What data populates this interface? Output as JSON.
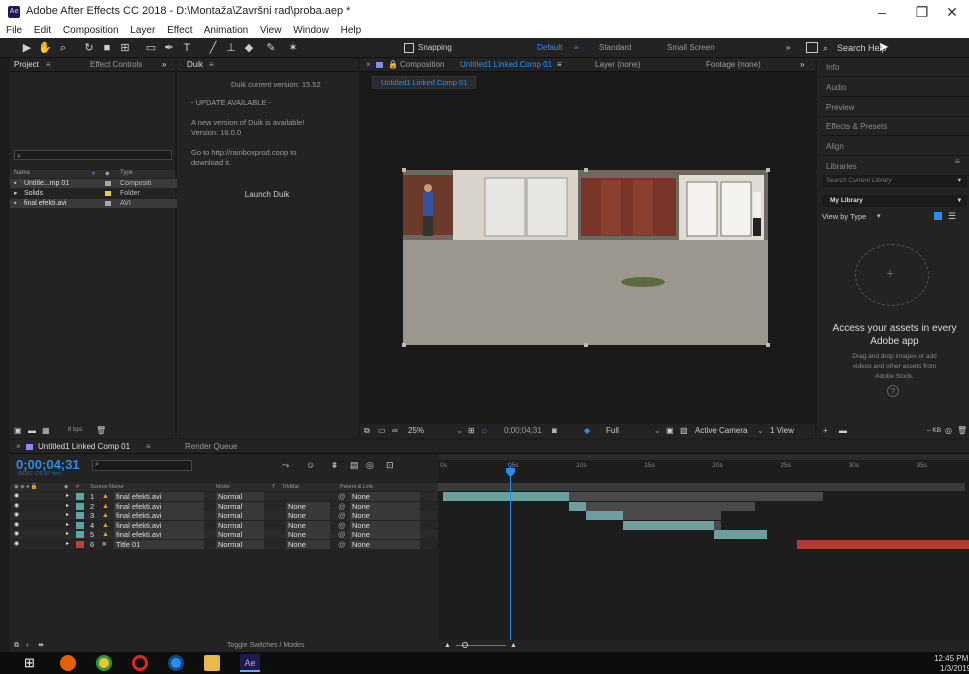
{
  "window": {
    "title": "Adobe After Effects CC 2018 - D:\\Montaža\\Završni rad\\proba.aep *",
    "app_icon": "Ae",
    "minimize": "–",
    "restore": "❐",
    "close": "✕"
  },
  "menu": [
    "File",
    "Edit",
    "Composition",
    "Layer",
    "Effect",
    "Animation",
    "View",
    "Window",
    "Help"
  ],
  "toolbar": {
    "snapping": "Snapping",
    "workspaces": [
      "Default",
      "≡",
      "Standard",
      "Small Screen"
    ],
    "search_help": "Search Help"
  },
  "project": {
    "tab_project": "Project",
    "tab_effect_controls": "Effect Controls",
    "col_name": "Name",
    "col_type": "Type",
    "items": [
      {
        "name": "Untitle...mp 01",
        "type": "Compositi",
        "color": "#a7a7a7"
      },
      {
        "name": "Solids",
        "type": "Folder",
        "color": "#e2d04a"
      },
      {
        "name": "final efekti.avi",
        "type": "AVI",
        "color": "#a7a7a7"
      }
    ],
    "bpc": "8 bpc"
  },
  "duik": {
    "tab": "Duik",
    "version": "Duik current version: 15.52",
    "update": "- UPDATE AVAILABLE -",
    "new_version": "A new version of Duik is available!",
    "version_num": "Version: 16.0.0",
    "goto": "Go to http://rainboxprod.coop to",
    "download": "download it.",
    "launch": "Launch Duik"
  },
  "composition": {
    "tab_label": "Composition",
    "comp_name": "Untitled1 Linked Comp 01",
    "layer_tab": "Layer (none)",
    "footage_tab": "Footage (none)",
    "sub_tab": "Untitled1 Linked Comp 01",
    "zoom": "25%",
    "timecode": "0;00;04;31",
    "resolution": "Full",
    "camera": "Active Camera",
    "views": "1 View"
  },
  "right_panels": {
    "items": [
      "Info",
      "Audio",
      "Preview",
      "Effects & Presets",
      "Align",
      "Libraries"
    ],
    "search_library": "Search Current Library",
    "my_library": "My Library",
    "view_by_type": "View by Type",
    "access_title_1": "Access your assets in every",
    "access_title_2": "Adobe app",
    "access_desc_1": "Drag and drop images or add",
    "access_desc_2": "videos and other assets from",
    "access_desc_3": "Adobe Stock.",
    "kb": "– KB"
  },
  "timeline": {
    "tab": "Untitled1 Linked Comp 01",
    "render_queue": "Render Queue",
    "timecode": "0;00;04;31",
    "fps": "00151 (29.97 fps)",
    "col_source": "Source Name",
    "col_mode": "Mode",
    "col_t": "T",
    "col_trkmat": "TrkMat",
    "col_parent": "Parent & Link",
    "ruler": [
      "0s",
      "05s",
      "10s",
      "15s",
      "20s",
      "25s",
      "30s",
      "35s"
    ],
    "layers": [
      {
        "num": "1",
        "name": "final efekti.avi",
        "mode": "Normal",
        "trkmat": "",
        "parent": "None",
        "label": "#5ea5a5",
        "icon": "avi",
        "bar_start": 0.7,
        "bar_end": 19.2,
        "in_start": 0.7,
        "in_end": 19.2,
        "bg_end": 56.5
      },
      {
        "num": "2",
        "name": "final efekti.avi",
        "mode": "Normal",
        "trkmat": "None",
        "parent": "None",
        "label": "#5ea5a5",
        "icon": "avi",
        "bar_start": 19.2,
        "bar_end": 21.8,
        "in_start": 19.2,
        "in_end": 21.8,
        "bg_end": 46.5
      },
      {
        "num": "3",
        "name": "final efekti.avi",
        "mode": "Normal",
        "trkmat": "None",
        "parent": "None",
        "label": "#5ea5a5",
        "icon": "avi",
        "bar_start": 21.8,
        "bar_end": 27.2,
        "in_start": 21.8,
        "in_end": 27.2,
        "bg_end": 41.5
      },
      {
        "num": "4",
        "name": "final efekti.avi",
        "mode": "Normal",
        "trkmat": "None",
        "parent": "None",
        "label": "#5ea5a5",
        "icon": "avi",
        "bar_start": 27.2,
        "bar_end": 40.5,
        "in_start": 27.2,
        "in_end": 40.5,
        "bg_end": 41.5
      },
      {
        "num": "5",
        "name": "final efekti.avi",
        "mode": "Normal",
        "trkmat": "None",
        "parent": "None",
        "label": "#5ea5a5",
        "icon": "avi",
        "bar_start": 40.5,
        "bar_end": 48.3,
        "in_start": 40.5,
        "in_end": 48.3,
        "bg_end": 48.3
      },
      {
        "num": "6",
        "name": "Title 01",
        "mode": "Normal",
        "trkmat": "None",
        "parent": "None",
        "label": "#c04040",
        "icon": "solid",
        "bar_start": 52.8,
        "bar_end": 83,
        "in_start": 52.8,
        "in_end": 83,
        "bg_end": 83
      }
    ],
    "playhead_s": 5,
    "toggle": "Toggle Switches / Modes"
  },
  "taskbar": {
    "time": "12:45 PM",
    "date": "1/3/2019"
  },
  "colors": {
    "accent_blue": "#2d8ceb",
    "layer_bar": "#6f9e9f",
    "title_bar": "#b03a3a"
  }
}
